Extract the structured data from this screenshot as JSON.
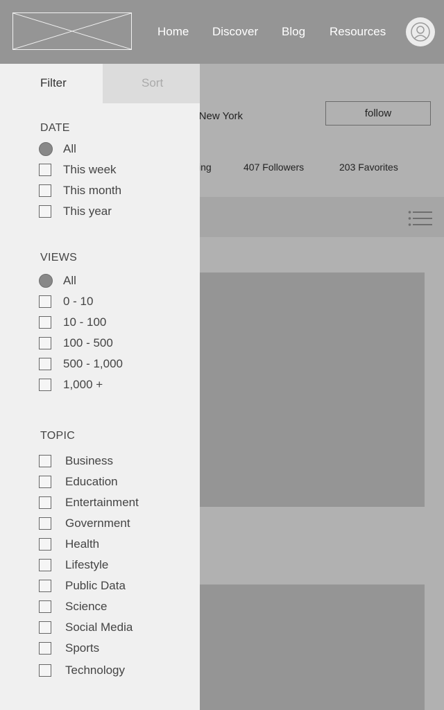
{
  "header": {
    "nav": [
      "Home",
      "Discover",
      "Blog",
      "Resources"
    ]
  },
  "profile": {
    "location": "n, New York",
    "follow_label": "follow",
    "stats": [
      "ing",
      "407 Followers",
      "203 Favorites"
    ]
  },
  "panel": {
    "tabs": {
      "filter": "Filter",
      "sort": "Sort"
    },
    "date": {
      "title": "DATE",
      "options": [
        "All",
        "This week",
        "This month",
        "This year"
      ]
    },
    "views": {
      "title": "VIEWS",
      "options": [
        "All",
        "0 - 10",
        "10 - 100",
        "100 - 500",
        "500 - 1,000",
        "1,000 +"
      ]
    },
    "topic": {
      "title": "TOPIC",
      "options": [
        "Business",
        "Education",
        "Entertainment",
        "Government",
        "Health",
        "Lifestyle",
        "Public Data",
        "Science",
        "Social Media",
        "Sports",
        "Technology"
      ]
    }
  }
}
